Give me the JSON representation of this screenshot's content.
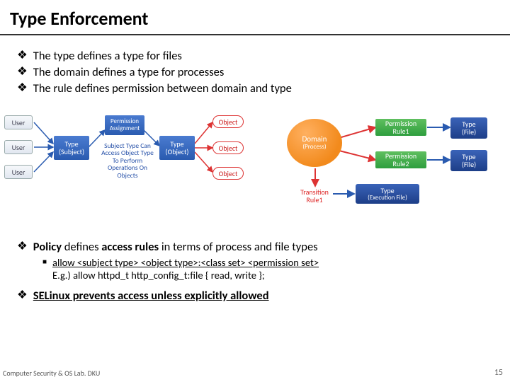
{
  "title": "Type Enforcement",
  "top_bullets": [
    "The type defines a type for files",
    "The domain defines a type for processes",
    "The rule defines permission between domain and type"
  ],
  "diagram": {
    "users": [
      "User",
      "User",
      "User"
    ],
    "type_subject": {
      "l1": "Type",
      "l2": "(Subject)"
    },
    "perm_assign": {
      "l1": "Permission",
      "l2": "Assignment"
    },
    "subject_caption": "Subject Type Can Access Object Type To Perform Operations On Objects",
    "type_object": {
      "l1": "Type",
      "l2": "(Object)"
    },
    "objects": [
      "Object",
      "Object",
      "Object"
    ],
    "domain": {
      "l1": "Domain",
      "l2": "(Process)"
    },
    "perm_rules": [
      "Permission Rule1",
      "Permission Rule2"
    ],
    "transition": "Transition Rule1",
    "type_file": {
      "l1": "Type",
      "l2": "(File)"
    },
    "type_exec": {
      "l1": "Type",
      "l2": "(Execution File)"
    }
  },
  "policy_bullet": {
    "lead": "Policy",
    "mid": " defines ",
    "rules": "access rules",
    "tail": " in terms of process and file types"
  },
  "sub_bullet": {
    "line1": "allow <subject type> <object type>:<class set> <permission set>",
    "line2": "E.g.) allow httpd_t http_config_t:file { read, write };"
  },
  "selinux_bullet": "SELinux prevents access unless explicitly allowed",
  "footer_left": "Computer Security & OS Lab. DKU",
  "footer_right": "15"
}
